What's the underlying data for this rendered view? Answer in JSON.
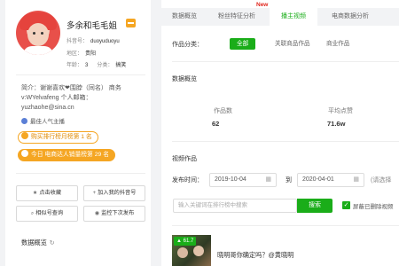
{
  "profile": {
    "name": "多余和毛毛姐",
    "id_label": "抖音号：",
    "id_value": "duoyuduoyu",
    "region_label": "地区：",
    "region_value": "贵阳",
    "age_label": "年龄：",
    "age_value": "3",
    "category_label": "分类：",
    "category_value": "搞笑",
    "bio_line1": "简介：谢谢喜欢❤围脖（同名） 商务",
    "bio_line2": "v:WYelvafeng 个人邮箱：",
    "bio_line3": "yuzhaohe@sina.cn",
    "tag": "最佳人气主播",
    "rank1": "购买排行榜月榜第 1 名",
    "rank2": "今日 电商达人销量榜第 29 名"
  },
  "actions": {
    "favorite": "点击收藏",
    "add_to_list": "加入我的抖音号",
    "similar": "相似号查询",
    "monitor": "监控下次发布"
  },
  "left_section_title": "数据概览",
  "tabs": [
    "数据概览",
    "粉丝特征分析",
    "播主视频",
    "电商数据分析"
  ],
  "active_tab_index": 2,
  "new_badge": "New",
  "filter": {
    "label": "作品分类：",
    "options": [
      "全部",
      "关联商品作品",
      "商业作品"
    ],
    "active_index": 0
  },
  "overview": {
    "title": "数据概览",
    "works_label": "作品数",
    "works_value": "62",
    "avg_likes_label": "平均点赞",
    "avg_likes_value": "71.6w"
  },
  "videos": {
    "title": "视频作品",
    "publish_time_label": "发布时间：",
    "date_from": "2019-10-04",
    "date_to_label": "到",
    "date_to": "2020-04-01",
    "date_hint": "(请选择",
    "search_placeholder": "输入关键词在排行榜中搜索",
    "search_button": "搜索",
    "hide_deleted_label": "屏蔽已删除视频",
    "hide_deleted_checked": true,
    "first_video": {
      "score": "61.7",
      "title": "晓明哥你确定吗？@黄晓明"
    }
  },
  "colors": {
    "accent_green": "#1aad19",
    "rank_orange": "#f5a623",
    "new_red": "#e0251c"
  }
}
